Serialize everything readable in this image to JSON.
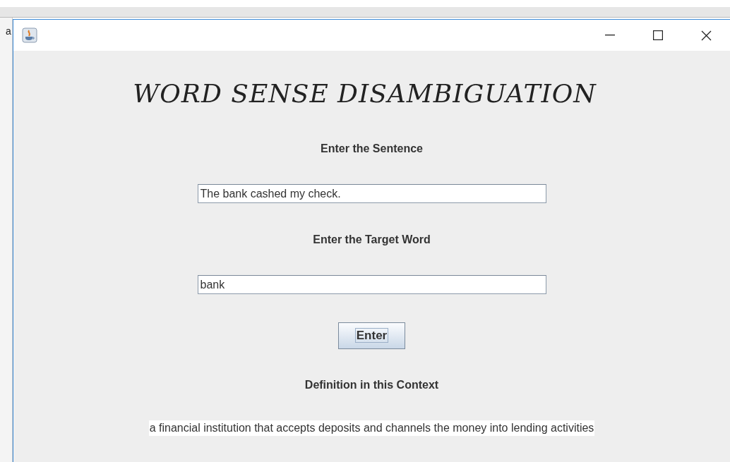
{
  "background": {
    "text": "a"
  },
  "heading": "WORD SENSE DISAMBIGUATION",
  "fields": [
    {
      "label": "Enter the Sentence",
      "value": "The bank cashed my check."
    },
    {
      "label": "Enter the Target Word",
      "value": "bank"
    }
  ],
  "button": {
    "label": "Enter",
    "focused": true
  },
  "result": {
    "label": "Definition in this Context",
    "text": "a financial institution that accepts deposits and channels the money into lending activities"
  }
}
